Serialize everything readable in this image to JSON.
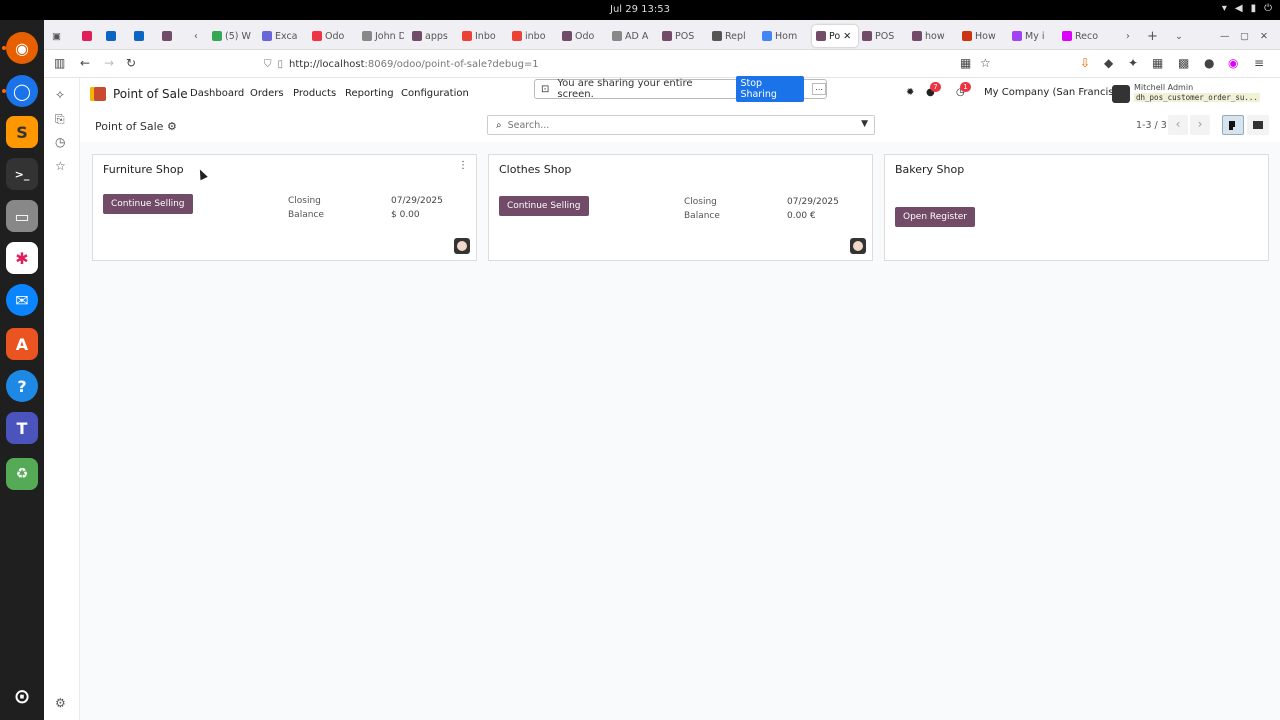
{
  "system": {
    "clock": "Jul 29  13:53"
  },
  "browser": {
    "tabs": [
      {
        "label": "(5) W",
        "color": "#34a853"
      },
      {
        "label": "Exca",
        "color": "#6965db"
      },
      {
        "label": "Odo",
        "color": "#e34"
      },
      {
        "label": "John Do",
        "color": "#888"
      },
      {
        "label": "apps",
        "color": "#714b67"
      },
      {
        "label": "Inbo",
        "color": "#ea4335"
      },
      {
        "label": "inbo",
        "color": "#ea4335"
      },
      {
        "label": "Odo",
        "color": "#714b67"
      },
      {
        "label": "AD A",
        "color": "#888"
      },
      {
        "label": "POS",
        "color": "#714b67"
      },
      {
        "label": "Repl",
        "color": "#555"
      },
      {
        "label": "Hom",
        "color": "#4285f4"
      },
      {
        "label": "Po",
        "color": "#714b67"
      },
      {
        "label": "POS",
        "color": "#714b67"
      },
      {
        "label": "how",
        "color": "#714b67"
      },
      {
        "label": "How",
        "color": "#c31"
      },
      {
        "label": "My i",
        "color": "#a142f4"
      },
      {
        "label": "Reco",
        "color": "#d0f"
      }
    ],
    "url_host": "http://localhost",
    "url_rest": ":8069/odoo/point-of-sale?debug=1"
  },
  "share_banner": {
    "text": "You are sharing your entire screen.",
    "stop_label": "Stop Sharing",
    "hide_label": "..."
  },
  "odoo": {
    "app_name": "Point of Sale",
    "menu": [
      "Dashboard",
      "Orders",
      "Products",
      "Reporting",
      "Configuration"
    ],
    "messages_count": "7",
    "activities_count": "1",
    "company": "My Company (San Francisco)",
    "user_name": "Mitchell Admin",
    "database": "dh_pos_customer_order_su..."
  },
  "control_panel": {
    "breadcrumb": "Point of Sale",
    "search_placeholder": "Search...",
    "pager": "1-3 / 3"
  },
  "cards": [
    {
      "title": "Furniture Shop",
      "button": "Continue Selling",
      "closing_label": "Closing",
      "balance_label": "Balance",
      "closing_date": "07/29/2025",
      "balance_value": "$ 0.00"
    },
    {
      "title": "Clothes Shop",
      "button": "Continue Selling",
      "closing_label": "Closing",
      "balance_label": "Balance",
      "closing_date": "07/29/2025",
      "balance_value": "0.00 €"
    },
    {
      "title": "Bakery Shop",
      "button": "Open Register"
    }
  ]
}
